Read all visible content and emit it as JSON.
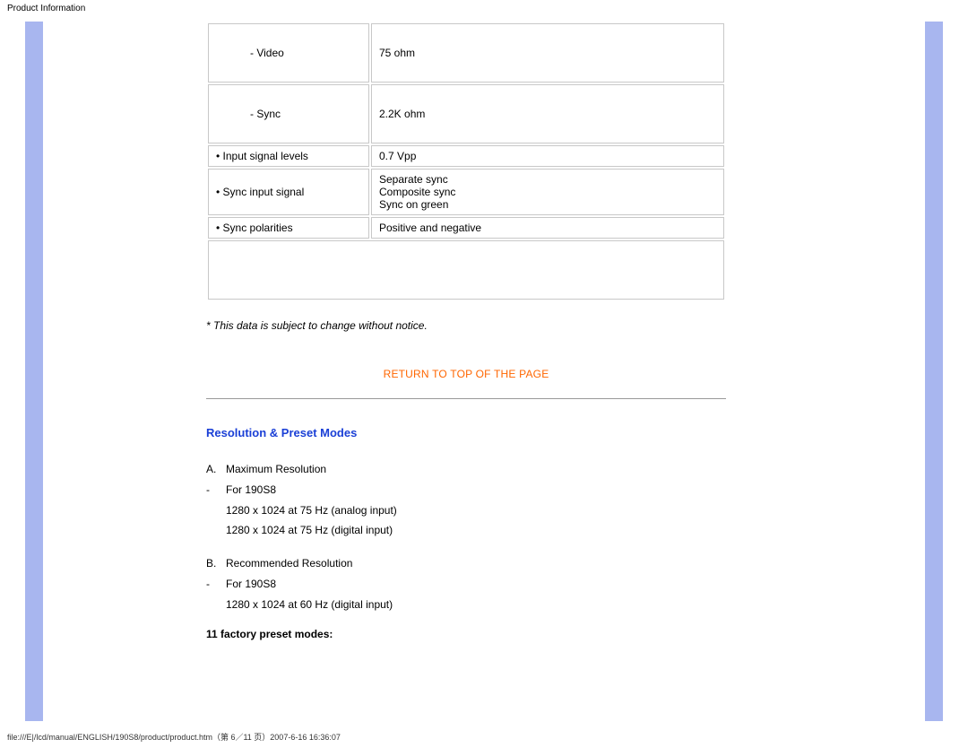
{
  "header": {
    "title": "Product Information"
  },
  "footer": {
    "path": "file:///E|/lcd/manual/ENGLISH/190S8/product/product.htm（第 6／11 页）2007-6-16 16:36:07"
  },
  "spec_table": {
    "rows": [
      {
        "label": "- Video",
        "value": "75 ohm",
        "tall": true
      },
      {
        "label": "- Sync",
        "value": "2.2K ohm",
        "tall": true
      },
      {
        "label": "• Input signal levels",
        "value": "0.7 Vpp"
      },
      {
        "label": "• Sync input signal",
        "value": "Separate sync\nComposite sync\nSync on green"
      },
      {
        "label": "• Sync polarities",
        "value": "Positive and negative"
      }
    ]
  },
  "note": "* This data is subject to change without notice.",
  "toplink": "RETURN TO TOP OF THE PAGE",
  "section": {
    "title": "Resolution & Preset Modes"
  },
  "modes": {
    "items": [
      {
        "marker": "A.",
        "text": "Maximum Resolution"
      },
      {
        "marker": "-",
        "text": "For 190S8"
      },
      {
        "marker": "",
        "text": "1280 x 1024 at 75 Hz (analog input)"
      },
      {
        "marker": "",
        "text": "1280 x 1024 at 75 Hz (digital input)"
      },
      {
        "marker": "B.",
        "text": "Recommended Resolution"
      },
      {
        "marker": "-",
        "text": "For 190S8"
      },
      {
        "marker": "",
        "text": "1280 x 1024 at 60 Hz (digital input)"
      }
    ],
    "gaps_after": [
      3
    ]
  },
  "factory": "11 factory preset modes:"
}
